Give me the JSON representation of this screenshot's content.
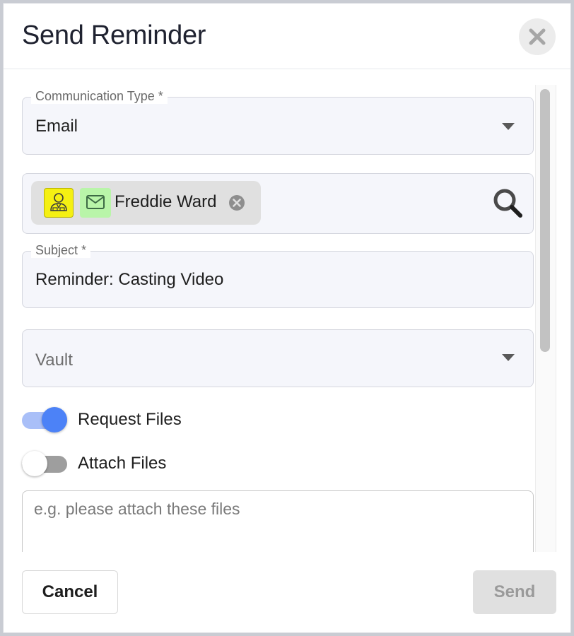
{
  "dialog": {
    "title": "Send Reminder",
    "close_icon": "close-icon"
  },
  "form": {
    "communication_type": {
      "label": "Communication Type *",
      "value": "Email",
      "icon": "chevron-down-icon"
    },
    "recipients": {
      "chips": [
        {
          "name": "Freddie Ward",
          "role_icon": "person-icon",
          "channel_icon": "envelope-icon",
          "remove_icon": "remove-circle-icon"
        }
      ],
      "search_icon": "search-icon"
    },
    "subject": {
      "label": "Subject *",
      "value": "Reminder: Casting Video"
    },
    "vault": {
      "placeholder": "Vault",
      "icon": "chevron-down-icon"
    },
    "request_files": {
      "label": "Request Files",
      "on": true
    },
    "attach_files": {
      "label": "Attach Files",
      "on": false
    },
    "message": {
      "placeholder": "e.g. please attach these files"
    }
  },
  "footer": {
    "cancel_label": "Cancel",
    "send_label": "Send",
    "send_enabled": false
  },
  "colors": {
    "toggle_on_track": "#a9bff8",
    "toggle_on_knob": "#4c82f7",
    "toggle_off_track": "#9e9e9e",
    "toggle_off_knob": "#ffffff",
    "chip_role_bg": "#f5f012",
    "chip_channel_bg": "#b9f5a9"
  }
}
